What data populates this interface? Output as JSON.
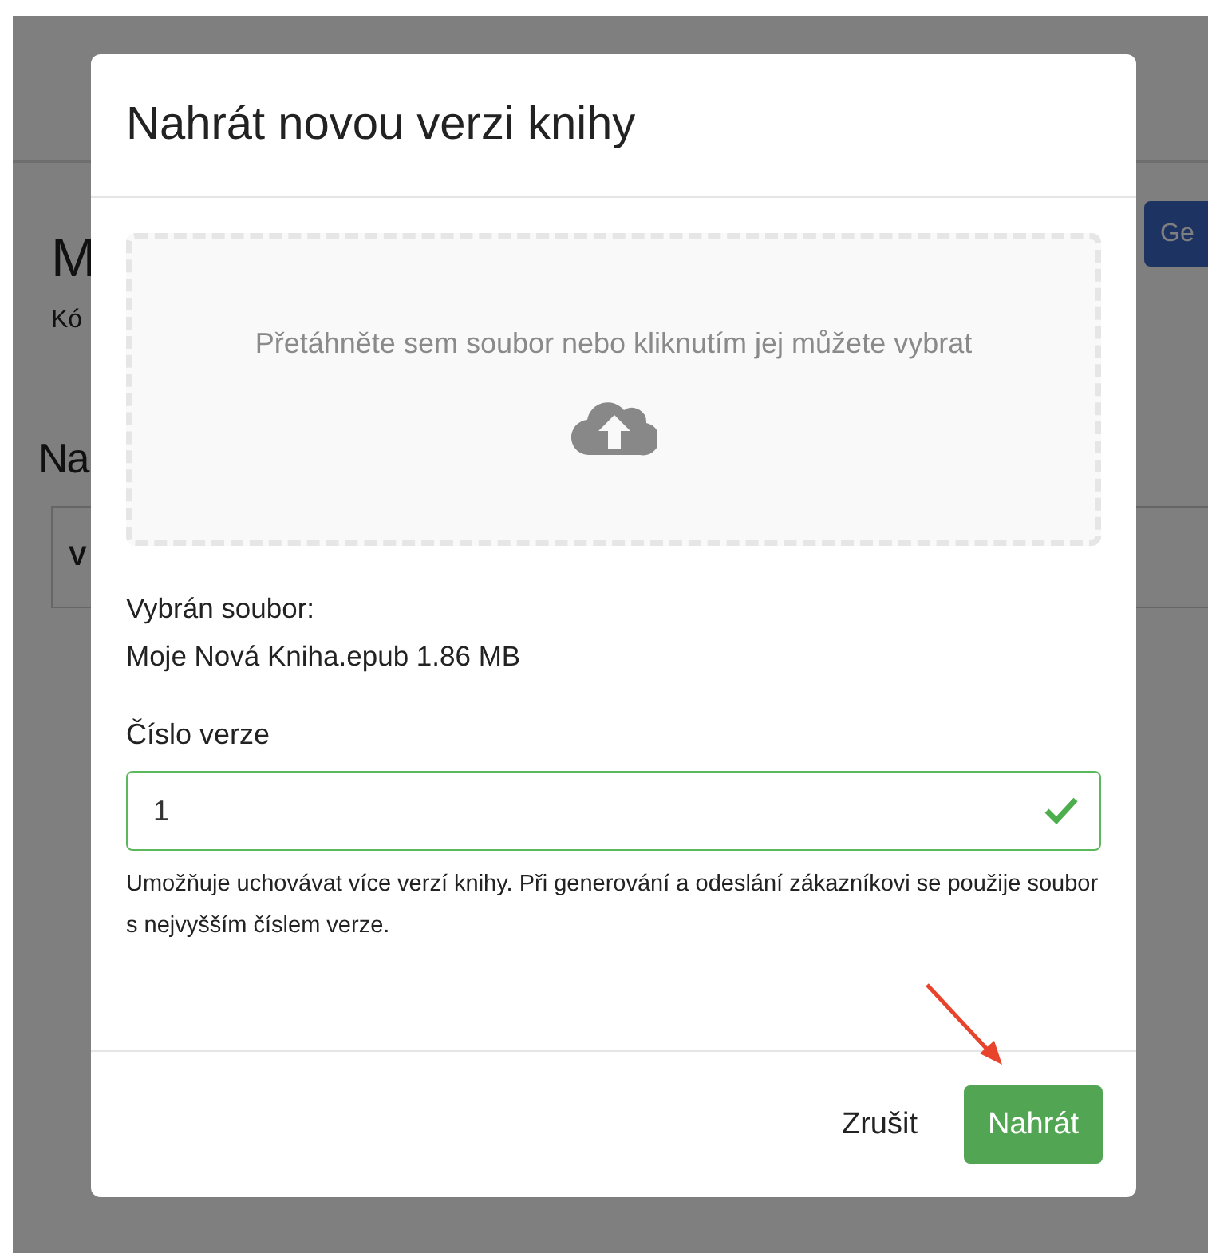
{
  "background_page": {
    "heading": "M",
    "code_label": "Kó",
    "section_heading": "Na",
    "table_cell": "V",
    "button": "Ge"
  },
  "dialog": {
    "title": "Nahrát novou verzi knihy",
    "dropzone": {
      "prompt": "Přetáhněte sem soubor nebo kliknutím jej můžete vybrat"
    },
    "selected_file": {
      "label": "Vybrán soubor:",
      "file": "Moje Nová Kniha.epub 1.86 MB"
    },
    "version_field": {
      "label": "Číslo verze",
      "value": "1",
      "valid": true,
      "help": "Umožňuje uchovávat více verzí knihy. Při generování a odeslání zákazníkovi se použije soubor s nejvyšším číslem verze."
    },
    "buttons": [
      {
        "label": "Zrušit",
        "kind": "link"
      },
      {
        "label": "Nahrát",
        "kind": "primary"
      }
    ]
  }
}
